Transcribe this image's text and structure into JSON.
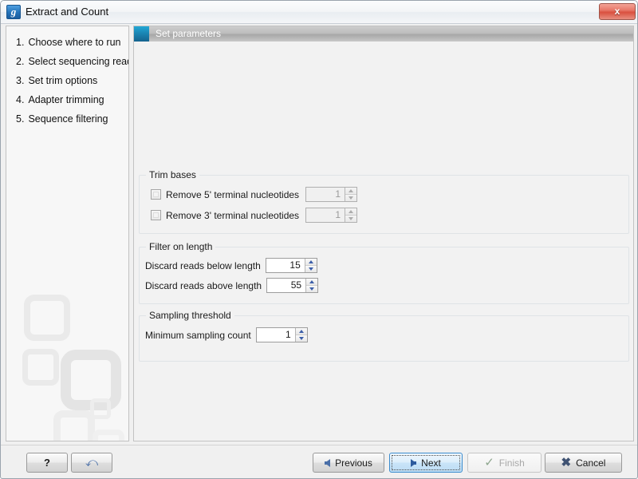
{
  "window": {
    "title": "Extract and Count",
    "app_icon": "clc-workbench-icon",
    "close_label": "x"
  },
  "sidebar": {
    "steps": [
      {
        "num": "1.",
        "label": "Choose where to run"
      },
      {
        "num": "2.",
        "label": "Select sequencing reads"
      },
      {
        "num": "3.",
        "label": "Set trim options"
      },
      {
        "num": "4.",
        "label": "Adapter trimming"
      },
      {
        "num": "5.",
        "label": "Sequence filtering"
      }
    ]
  },
  "main": {
    "section_header": "Set parameters",
    "groups": {
      "trim_bases": {
        "title": "Trim bases",
        "rows": [
          {
            "label": "Remove 5' terminal nucleotides",
            "checked": false,
            "value": "1",
            "enabled": false
          },
          {
            "label": "Remove 3' terminal nucleotides",
            "checked": false,
            "value": "1",
            "enabled": false
          }
        ]
      },
      "filter_on_length": {
        "title": "Filter on length",
        "rows": [
          {
            "label": "Discard reads below length",
            "value": "15",
            "enabled": true
          },
          {
            "label": "Discard reads above length",
            "value": "55",
            "enabled": true
          }
        ]
      },
      "sampling_threshold": {
        "title": "Sampling threshold",
        "rows": [
          {
            "label": "Minimum sampling count",
            "value": "1",
            "enabled": true
          }
        ]
      }
    }
  },
  "buttons": {
    "help": "?",
    "reset_icon": "undo-arrow-icon",
    "previous": "Previous",
    "next": "Next",
    "finish": "Finish",
    "cancel": "Cancel"
  },
  "colors": {
    "accent_blue": "#2472b8",
    "header_teal": "#1b86b4",
    "focus_blue": "#3c8ccd",
    "close_red": "#d9503f",
    "dialog_bg": "#f0f0f0"
  }
}
